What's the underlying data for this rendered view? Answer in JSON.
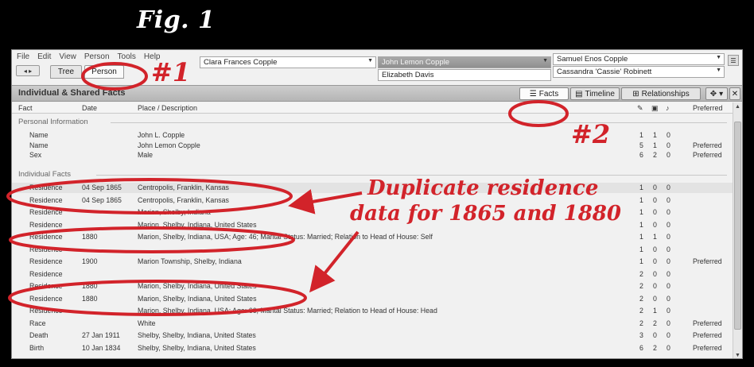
{
  "figure": {
    "title": "Fig. 1"
  },
  "menu": {
    "items": [
      "File",
      "Edit",
      "View",
      "Person",
      "Tools",
      "Help"
    ]
  },
  "nav": {
    "arrows": "◂ ▸",
    "tabs": [
      {
        "label": "Tree",
        "active": false
      },
      {
        "label": "Person",
        "active": true
      }
    ]
  },
  "person_bar": {
    "current_person": "Clara Frances Copple",
    "father": "John Lemon Copple",
    "mother": "Elizabeth Davis",
    "grandfather": "Samuel Enos Copple",
    "grandmother": "Cassandra 'Cassie' Robinett"
  },
  "panel": {
    "title": "Individual & Shared Facts",
    "view_buttons": [
      {
        "label": "Facts",
        "icon": "list-icon",
        "active": true
      },
      {
        "label": "Timeline",
        "icon": "timeline-icon",
        "active": false
      },
      {
        "label": "Relationships",
        "icon": "relationships-icon",
        "active": false
      }
    ],
    "tool_icons": [
      "✥",
      "▾",
      "✕"
    ]
  },
  "columns": {
    "fact": "Fact",
    "date": "Date",
    "place": "Place / Description",
    "src_icon": "✎",
    "media_icon": "▣",
    "note_icon": "♪",
    "preferred": "Preferred"
  },
  "sections": {
    "personal": "Personal Information",
    "individual": "Individual Facts"
  },
  "personal_facts": [
    {
      "fact": "Name",
      "date": "",
      "place": "John L. Copple",
      "n1": "1",
      "n2": "1",
      "n3": "0",
      "pref": ""
    },
    {
      "fact": "Name",
      "date": "",
      "place": "John Lemon Copple",
      "n1": "5",
      "n2": "1",
      "n3": "0",
      "pref": "Preferred"
    },
    {
      "fact": "Sex",
      "date": "",
      "place": "Male",
      "n1": "6",
      "n2": "2",
      "n3": "0",
      "pref": "Preferred"
    }
  ],
  "individual_facts": [
    {
      "fact": "Residence",
      "date": "04 Sep 1865",
      "place": "Centropolis, Franklin, Kansas",
      "n1": "1",
      "n2": "0",
      "n3": "0",
      "pref": "",
      "highlight": true
    },
    {
      "fact": "Residence",
      "date": "04 Sep 1865",
      "place": "Centropolis, Franklin, Kansas",
      "n1": "1",
      "n2": "0",
      "n3": "0",
      "pref": ""
    },
    {
      "fact": "Residence",
      "date": "",
      "place": "Marion, Shelby, Indiana",
      "n1": "1",
      "n2": "0",
      "n3": "0",
      "pref": ""
    },
    {
      "fact": "Residence",
      "date": "",
      "place": "Marion, Shelby, Indiana, United States",
      "n1": "1",
      "n2": "0",
      "n3": "0",
      "pref": ""
    },
    {
      "fact": "Residence",
      "date": "1880",
      "place": "Marion, Shelby, Indiana, USA; Age: 46; Marital Status: Married; Relation to Head of House: Self",
      "n1": "1",
      "n2": "1",
      "n3": "0",
      "pref": ""
    },
    {
      "fact": "Residence",
      "date": "",
      "place": "",
      "n1": "1",
      "n2": "0",
      "n3": "0",
      "pref": ""
    },
    {
      "fact": "Residence",
      "date": "1900",
      "place": "Marion Township, Shelby, Indiana",
      "n1": "1",
      "n2": "0",
      "n3": "0",
      "pref": "Preferred"
    },
    {
      "fact": "Residence",
      "date": "",
      "place": "",
      "n1": "2",
      "n2": "0",
      "n3": "0",
      "pref": ""
    },
    {
      "fact": "Residence",
      "date": "1880",
      "place": "Marion, Shelby, Indiana, United States",
      "n1": "2",
      "n2": "0",
      "n3": "0",
      "pref": ""
    },
    {
      "fact": "Residence",
      "date": "1880",
      "place": "Marion, Shelby, Indiana, United States",
      "n1": "2",
      "n2": "0",
      "n3": "0",
      "pref": ""
    },
    {
      "fact": "Residence",
      "date": "",
      "place": "Marion, Shelby, Indiana, USA; Age: 66; Marital Status: Married; Relation to Head of House: Head",
      "n1": "2",
      "n2": "1",
      "n3": "0",
      "pref": ""
    },
    {
      "fact": "Race",
      "date": "",
      "place": "White",
      "n1": "2",
      "n2": "2",
      "n3": "0",
      "pref": "Preferred"
    },
    {
      "fact": "Death",
      "date": "27 Jan 1911",
      "place": "Shelby, Shelby, Indiana, United States",
      "n1": "3",
      "n2": "0",
      "n3": "0",
      "pref": "Preferred"
    },
    {
      "fact": "Birth",
      "date": "10 Jan 1834",
      "place": "Shelby, Shelby, Indiana, United States",
      "n1": "6",
      "n2": "2",
      "n3": "0",
      "pref": "Preferred"
    }
  ],
  "annotations": {
    "label1": "#1",
    "label2": "#2",
    "callout_line1": "Duplicate residence",
    "callout_line2": "data for 1865 and 1880",
    "color": "#d2232a"
  }
}
